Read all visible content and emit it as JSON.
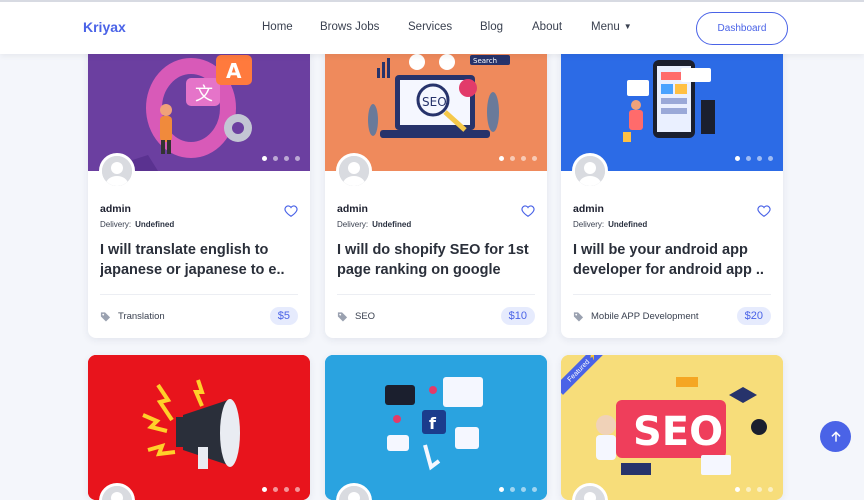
{
  "brand": {
    "name": "Kriyax",
    "accent": "#4a63e7"
  },
  "nav": {
    "items": [
      "Home",
      "Brows Jobs",
      "Services",
      "Blog",
      "About",
      "Menu"
    ],
    "dashboard_label": "Dashboard"
  },
  "cards": [
    {
      "seller": "admin",
      "delivery_label": "Delivery:",
      "delivery_value": "Undefined",
      "title_line1": "I will translate english to",
      "title_line2": "japanese or japanese to e..",
      "category": "Translation",
      "price": "$5",
      "image": "translation-illustration",
      "bg": "#6a3fa0"
    },
    {
      "seller": "admin",
      "delivery_label": "Delivery:",
      "delivery_value": "Undefined",
      "title_line1": "I will do shopify SEO for 1st",
      "title_line2": "page ranking on google",
      "category": "SEO",
      "price": "$10",
      "image": "seo-laptop-illustration",
      "bg": "#ef8a5c"
    },
    {
      "seller": "admin",
      "delivery_label": "Delivery:",
      "delivery_value": "Undefined",
      "title_line1": "I will be your android app",
      "title_line2": "developer for android app ..",
      "category": "Mobile APP Development",
      "price": "$20",
      "image": "android-app-illustration",
      "bg": "#2c6be6"
    },
    {
      "image": "megaphone-illustration",
      "bg": "#e8141c"
    },
    {
      "image": "social-media-illustration",
      "bg": "#2aa3e0"
    },
    {
      "image": "seo-banner-illustration",
      "bg": "#f7dd7a",
      "featured_label": "Featured"
    }
  ],
  "scroll_top_icon": "arrow-up-icon"
}
